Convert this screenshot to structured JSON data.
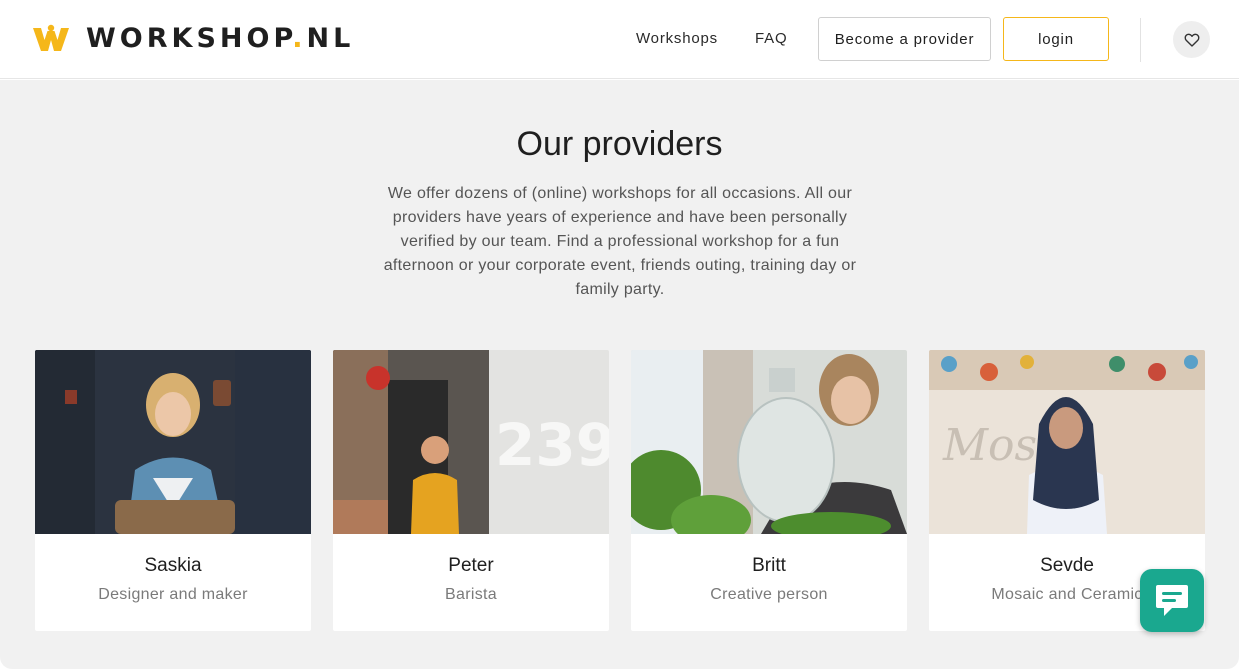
{
  "header": {
    "logo_text": "WORKSHOP",
    "logo_dot": ".",
    "logo_suffix": "NL",
    "nav": {
      "workshops": "Workshops",
      "faq": "FAQ"
    },
    "become_provider": "Become a provider",
    "login": "login",
    "favorites_icon": "heart-icon"
  },
  "main": {
    "title": "Our providers",
    "intro": "We offer dozens of (online) workshops for all occasions. All our providers have years of experience and have been personally verified by our team. Find a professional workshop for a fun afternoon or your corporate event, friends outing, training day or family party.",
    "providers": [
      {
        "name": "Saskia",
        "role": "Designer and maker"
      },
      {
        "name": "Peter",
        "role": "Barista"
      },
      {
        "name": "Britt",
        "role": "Creative person"
      },
      {
        "name": "Sevde",
        "role": "Mosaic and Ceramic"
      }
    ]
  },
  "chat": {
    "icon": "chat-icon"
  },
  "colors": {
    "brand_yellow": "#f5b71a",
    "chat_green": "#1aa88f",
    "page_background": "#f1f1f1"
  }
}
